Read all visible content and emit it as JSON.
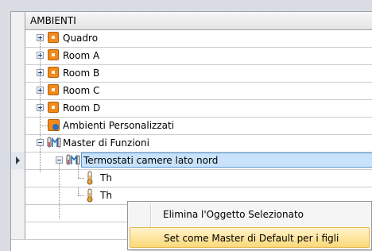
{
  "tree": {
    "header": "AMBIENTI",
    "rows": [
      {
        "label": "Quadro"
      },
      {
        "label": "Room A"
      },
      {
        "label": "Room B"
      },
      {
        "label": "Room C"
      },
      {
        "label": "Room D"
      },
      {
        "label": "Ambienti Personalizzati"
      },
      {
        "label": "Master di Funzioni"
      },
      {
        "label": "Termostati camere lato nord"
      },
      {
        "label": "Th"
      },
      {
        "label": "Th"
      }
    ]
  },
  "context_menu": {
    "items": [
      {
        "label": "Elimina l'Oggetto Selezionato"
      },
      {
        "label": "Set come Master di Default per i figli"
      }
    ]
  },
  "colors": {
    "room_icon": "#f08a1e",
    "selection": "#c7e2fa",
    "menu_hover": "#fbd97a"
  }
}
